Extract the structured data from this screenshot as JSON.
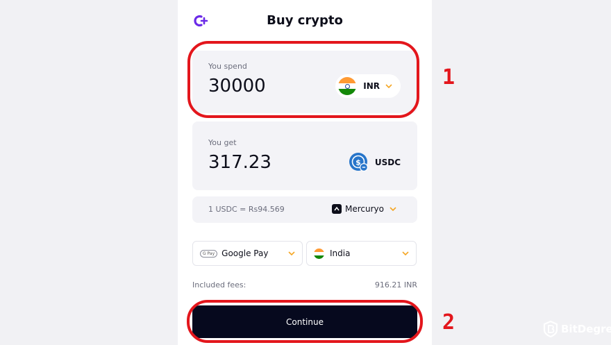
{
  "header": {
    "title": "Buy crypto",
    "logo_icon": "plus-logo-icon"
  },
  "spend": {
    "label": "You spend",
    "amount": "30000",
    "currency": "INR",
    "flag_icon": "india-flag-icon"
  },
  "get": {
    "label": "You get",
    "amount": "317.23",
    "currency": "USDC",
    "coin_icon": "usdc-icon"
  },
  "rate": {
    "text": "1 USDC = Rs94.569",
    "provider": "Mercuryo",
    "provider_icon": "mercuryo-icon"
  },
  "payment": {
    "method": "Google Pay",
    "badge": "G Pay",
    "country": "India"
  },
  "fees": {
    "label": "Included fees:",
    "value": "916.21 INR"
  },
  "cta": {
    "label": "Continue"
  },
  "annotations": {
    "first": "1",
    "second": "2"
  },
  "watermark": {
    "text": "BitDegree"
  },
  "colors": {
    "accent": "#e3161c",
    "brand_purple": "#6b2ae8",
    "chevron": "#f5a623",
    "button": "#06091e"
  }
}
